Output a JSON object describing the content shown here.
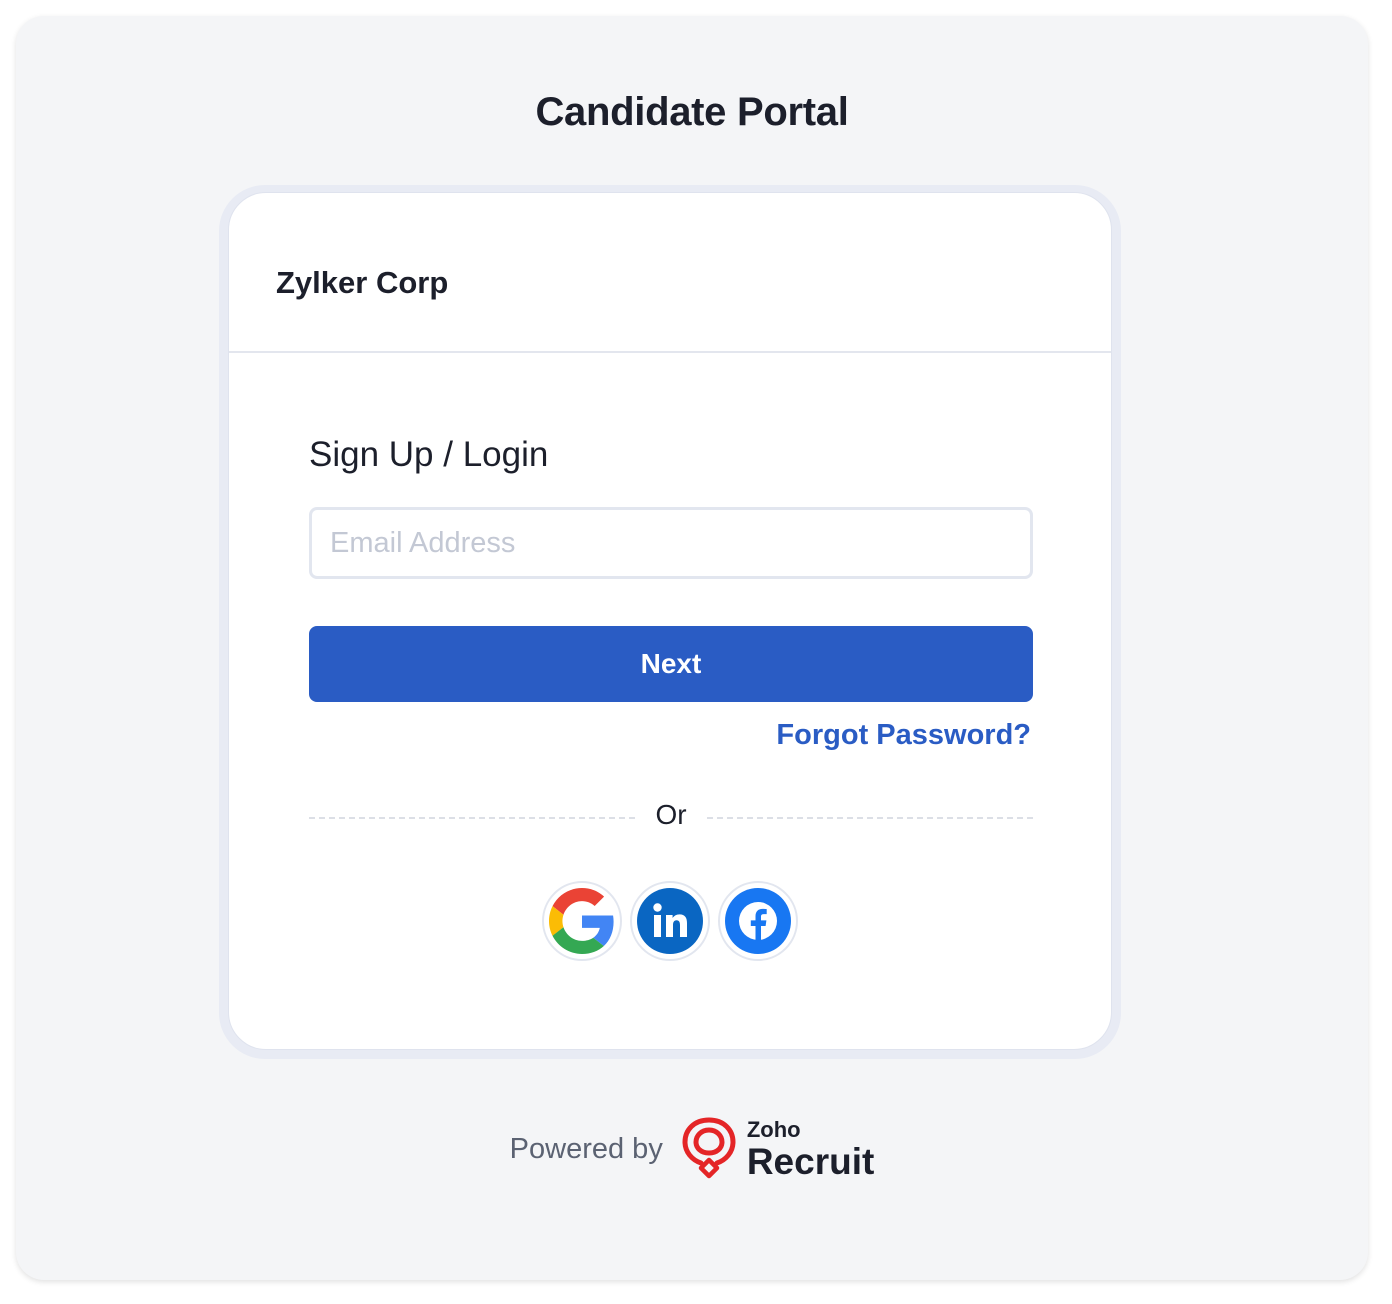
{
  "page": {
    "title": "Candidate Portal"
  },
  "card": {
    "company_name": "Zylker Corp",
    "heading": "Sign Up / Login",
    "email_placeholder": "Email Address",
    "email_value": "",
    "next_label": "Next",
    "forgot_label": "Forgot Password?",
    "divider_label": "Or"
  },
  "social": [
    {
      "name": "google",
      "icon": "google-icon"
    },
    {
      "name": "linkedin",
      "icon": "linkedin-icon"
    },
    {
      "name": "facebook",
      "icon": "facebook-icon"
    }
  ],
  "footer": {
    "powered_label": "Powered by",
    "brand_top": "Zoho",
    "brand_bottom": "Recruit"
  },
  "colors": {
    "accent": "#2a5cc4",
    "background": "#f4f5f7",
    "brand_red": "#e42527",
    "linkedin": "#0a66c2",
    "facebook": "#1877f2"
  }
}
